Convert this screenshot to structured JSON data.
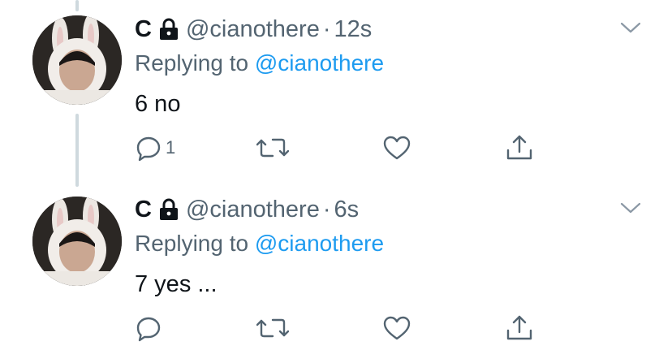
{
  "tweets": [
    {
      "name": "C",
      "handle": "@cianothere",
      "separator": "·",
      "time": "12s",
      "replying_prefix": "Replying to",
      "replying_to": "@cianothere",
      "text": "6 no",
      "reply_count": "1",
      "icons": [
        "lock-icon",
        "chevron-down-icon",
        "reply-icon",
        "retweet-icon",
        "like-icon",
        "share-icon"
      ]
    },
    {
      "name": "C",
      "handle": "@cianothere",
      "separator": "·",
      "time": "6s",
      "replying_prefix": "Replying to",
      "replying_to": "@cianothere",
      "text": "7 yes ...",
      "reply_count": "",
      "icons": [
        "lock-icon",
        "chevron-down-icon",
        "reply-icon",
        "retweet-icon",
        "like-icon",
        "share-icon"
      ]
    }
  ],
  "colors": {
    "text_primary": "#0f1419",
    "text_secondary": "#536471",
    "link": "#1d9bf0",
    "thread_line": "#cfd9de"
  }
}
